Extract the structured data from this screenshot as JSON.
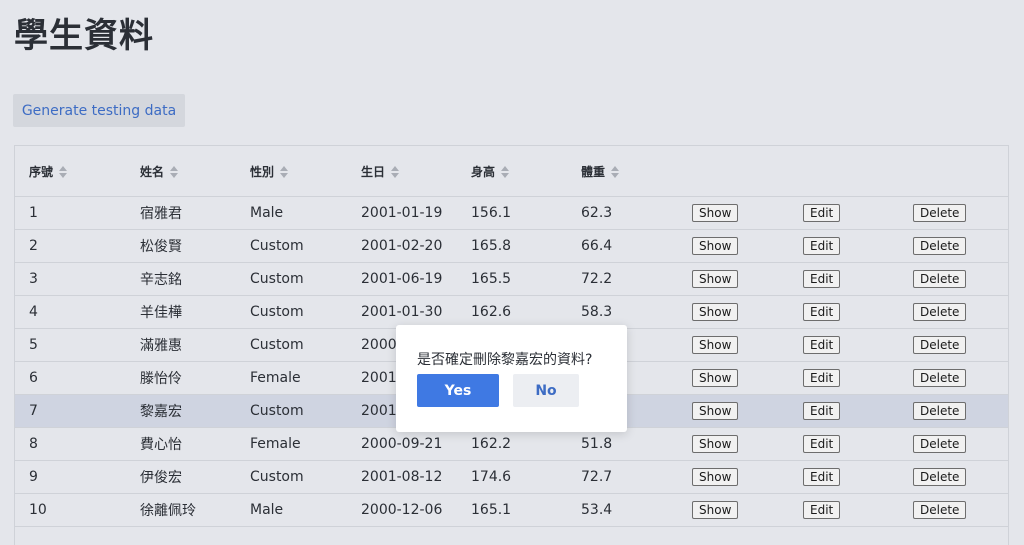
{
  "page": {
    "title": "學生資料"
  },
  "toolbar": {
    "generate_label": "Generate testing data"
  },
  "table": {
    "columns": [
      "序號",
      "姓名",
      "性別",
      "生日",
      "身高",
      "體重"
    ],
    "row_actions": {
      "show": "Show",
      "edit": "Edit",
      "delete": "Delete"
    },
    "rows": [
      {
        "id": "1",
        "name": "宿雅君",
        "gender": "Male",
        "birthday": "2001-01-19",
        "height": "156.1",
        "weight": "62.3"
      },
      {
        "id": "2",
        "name": "松俊賢",
        "gender": "Custom",
        "birthday": "2001-02-20",
        "height": "165.8",
        "weight": "66.4"
      },
      {
        "id": "3",
        "name": "辛志銘",
        "gender": "Custom",
        "birthday": "2001-06-19",
        "height": "165.5",
        "weight": "72.2"
      },
      {
        "id": "4",
        "name": "羊佳樺",
        "gender": "Custom",
        "birthday": "2001-01-30",
        "height": "162.6",
        "weight": "58.3"
      },
      {
        "id": "5",
        "name": "滿雅惠",
        "gender": "Custom",
        "birthday": "2000",
        "height": "",
        "weight": ""
      },
      {
        "id": "6",
        "name": "滕怡伶",
        "gender": "Female",
        "birthday": "2001-",
        "height": "",
        "weight": ""
      },
      {
        "id": "7",
        "name": "黎嘉宏",
        "gender": "Custom",
        "birthday": "2001-",
        "height": "",
        "weight": ""
      },
      {
        "id": "8",
        "name": "費心怡",
        "gender": "Female",
        "birthday": "2000-09-21",
        "height": "162.2",
        "weight": "51.8"
      },
      {
        "id": "9",
        "name": "伊俊宏",
        "gender": "Custom",
        "birthday": "2001-08-12",
        "height": "174.6",
        "weight": "72.7"
      },
      {
        "id": "10",
        "name": "徐離佩玲",
        "gender": "Male",
        "birthday": "2000-12-06",
        "height": "165.1",
        "weight": "53.4"
      }
    ],
    "selected_row_index": 6
  },
  "dialog": {
    "message": "是否確定刪除黎嘉宏的資料?",
    "yes_label": "Yes",
    "no_label": "No"
  },
  "colors": {
    "background": "#e4e6eb",
    "primary": "#3f79e3",
    "link": "#3d6cc4",
    "selected_row": "#cfd4e1"
  }
}
